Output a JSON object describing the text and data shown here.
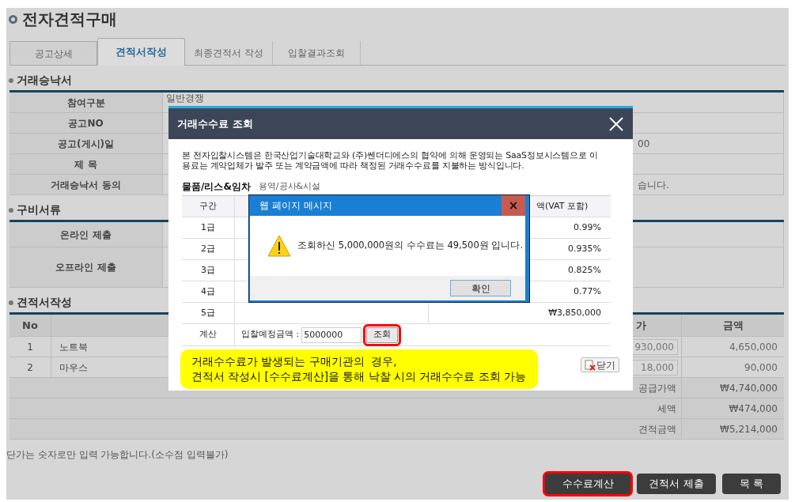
{
  "page_title": "전자견적구매",
  "tabs": [
    {
      "label": "공고상세",
      "selected": false
    },
    {
      "label": "견적서작성",
      "selected": true
    },
    {
      "label": "최종견적서 작성",
      "selected": false
    },
    {
      "label": "입찰결과조회",
      "selected": false
    }
  ],
  "acceptance": {
    "title": "거래승낙서",
    "rows": [
      {
        "label": "참여구분",
        "value": "일반경쟁"
      },
      {
        "label": "공고NO"
      },
      {
        "label": "공고(게시)일",
        "value_tail": "00"
      },
      {
        "label": "제 목"
      },
      {
        "label": "거래승낙서 동의",
        "value_tail": "습니다."
      }
    ]
  },
  "documents": {
    "title": "구비서류",
    "rows": [
      {
        "label": "온라인 제출"
      },
      {
        "label": "오프라인 제출"
      }
    ]
  },
  "quote": {
    "title": "견적서작성",
    "columns": [
      "No",
      "가",
      "금액"
    ],
    "items": [
      {
        "no": "1",
        "name": "노트북",
        "unit_price": "930,000",
        "amount": "4,650,000"
      },
      {
        "no": "2",
        "name": "마우스",
        "unit_price": "18,000",
        "amount": "90,000"
      }
    ],
    "totals": [
      {
        "label": "공급가액",
        "value": "₩4,740,000"
      },
      {
        "label": "세액",
        "value": "₩474,000"
      },
      {
        "label": "견적금액",
        "value": "₩5,214,000"
      }
    ]
  },
  "note": "단가는 숫자로만 입력 가능합니다.(소수점 입력불가)",
  "buttons": [
    {
      "label": "수수료계산",
      "highlighted": true
    },
    {
      "label": "견적서 제출",
      "highlighted": false
    },
    {
      "label": "목 록",
      "highlighted": false
    }
  ],
  "fee_dialog": {
    "title": "거래수수료 조회",
    "description_lines": [
      "본 전자입찰시스템은 한국산업기술대학교와 (주)쎈더디에스의 협약에 의해 운영되는 SaaS정보시스템으로 이",
      "용료는 계약업체가 발주 또는 계약금액에 따라 책정된 거래수수료를 지불하는 방식입니다."
    ],
    "categories": [
      {
        "label": "물품/리스&임차",
        "selected": true
      },
      {
        "label": "용역/공사&시설",
        "selected": false
      }
    ],
    "columns": [
      "구간",
      "액(VAT 포함)"
    ],
    "rows": [
      {
        "grade": "1급",
        "rate": "0.99%"
      },
      {
        "grade": "2급",
        "rate": "0.935%"
      },
      {
        "grade": "3급",
        "rate": "0.825%"
      },
      {
        "grade": "4급",
        "rate": "0.77%"
      },
      {
        "grade": "5급",
        "rate": "₩3,850,000"
      }
    ],
    "calc": {
      "label": "계산",
      "field_label": "입찰예정금액 :",
      "value": "5000000",
      "button": "조회",
      "button_highlighted": true
    },
    "callout": [
      "거래수수료가 발생되는 구매기관의  경우,",
      "견적서 작성시 [수수료계산]을 통해 낙찰 시의 거래수수료 조회 가능"
    ],
    "close_button": "닫기"
  },
  "alert": {
    "title": "웹 페이지 메시지",
    "close_glyph": "×",
    "message": "조회하신 5,000,000원의 수수료는 49,500원 입니다.",
    "button": "확인"
  }
}
